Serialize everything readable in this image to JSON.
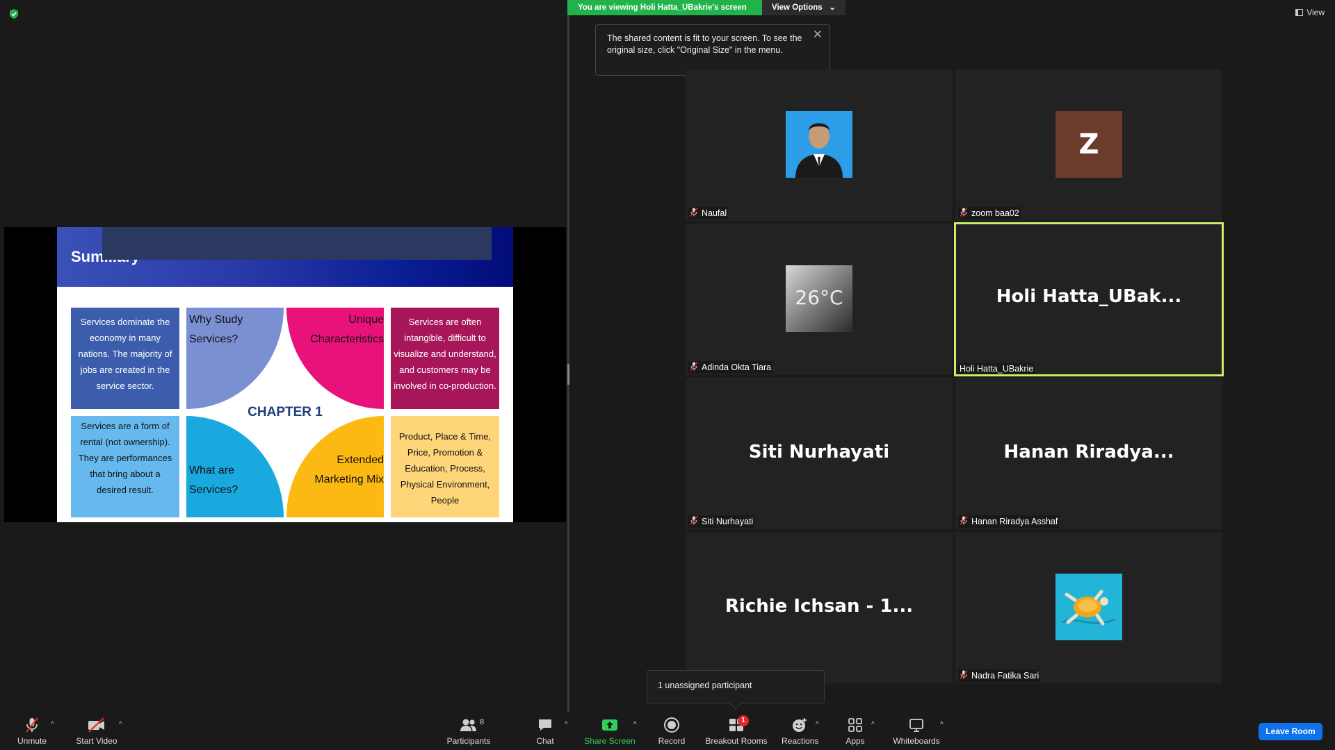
{
  "banner": {
    "viewing_text": "You are viewing Holi Hatta_UBakrie's screen",
    "options_label": "View Options",
    "options_caret": "⌄"
  },
  "tooltip": {
    "text": "The shared content is fit to your screen. To see the original size, click \"Original Size\" in the menu.",
    "close": "✕"
  },
  "view_button": {
    "label": "View"
  },
  "slide": {
    "title": "Sum...ary",
    "chapter": "CHAPTER 1",
    "quarters": {
      "why": "Why Study Services?",
      "unique": "Unique Characteristics",
      "what": "What are Services?",
      "extended": "Extended Marketing Mix"
    },
    "boxes": {
      "blue": "Services dominate the economy in many nations. The majority of jobs are created in the service sector.",
      "magenta": "Services are often intangible, difficult to visualize and understand, and customers may be involved in co-production.",
      "lightblue": "Services are a form of rental (not ownership). They are performances that bring about a desired result.",
      "yellow": "Product, Place & Time, Price, Promotion & Education, Process, Physical Environment, People"
    }
  },
  "participants": [
    {
      "name": "Naufal",
      "display": "",
      "avatar": "photo",
      "muted": true,
      "active": false
    },
    {
      "name": "zoom baa02",
      "display": "",
      "avatar": "letter",
      "letter": "Z",
      "muted": true,
      "active": false
    },
    {
      "name": "Adinda Okta Tiara",
      "display": "",
      "avatar": "photo-temp",
      "temp_text": "26°C",
      "muted": true,
      "active": false
    },
    {
      "name": "Holi Hatta_UBakrie",
      "display": "Holi  Hatta_UBak...",
      "avatar": "none",
      "muted": false,
      "active": true
    },
    {
      "name": "Siti Nurhayati",
      "display": "Siti Nurhayati",
      "avatar": "none",
      "muted": true,
      "active": false
    },
    {
      "name": "Hanan Riradya Asshaf",
      "display": "Hanan  Riradya...",
      "avatar": "none",
      "muted": true,
      "active": false
    },
    {
      "name": "",
      "display": "Richie Ichsan - 1...",
      "avatar": "none",
      "muted": false,
      "active": false
    },
    {
      "name": "Nadra Fatika Sari",
      "display": "",
      "avatar": "turtle",
      "muted": true,
      "active": false
    }
  ],
  "breakout_tip": "1 unassigned participant",
  "toolbar": {
    "unmute": "Unmute",
    "start_video": "Start Video",
    "participants": "Participants",
    "participants_count": "8",
    "chat": "Chat",
    "share_screen": "Share Screen",
    "record": "Record",
    "breakout_rooms": "Breakout Rooms",
    "breakout_badge": "1",
    "reactions": "Reactions",
    "apps": "Apps",
    "whiteboards": "Whiteboards",
    "leave": "Leave Room",
    "caret": "^"
  },
  "colors": {
    "active_border": "#c8ee6a",
    "share_green": "#21b34a",
    "leave_blue": "#0e72ed",
    "muted_red": "#e02828"
  }
}
